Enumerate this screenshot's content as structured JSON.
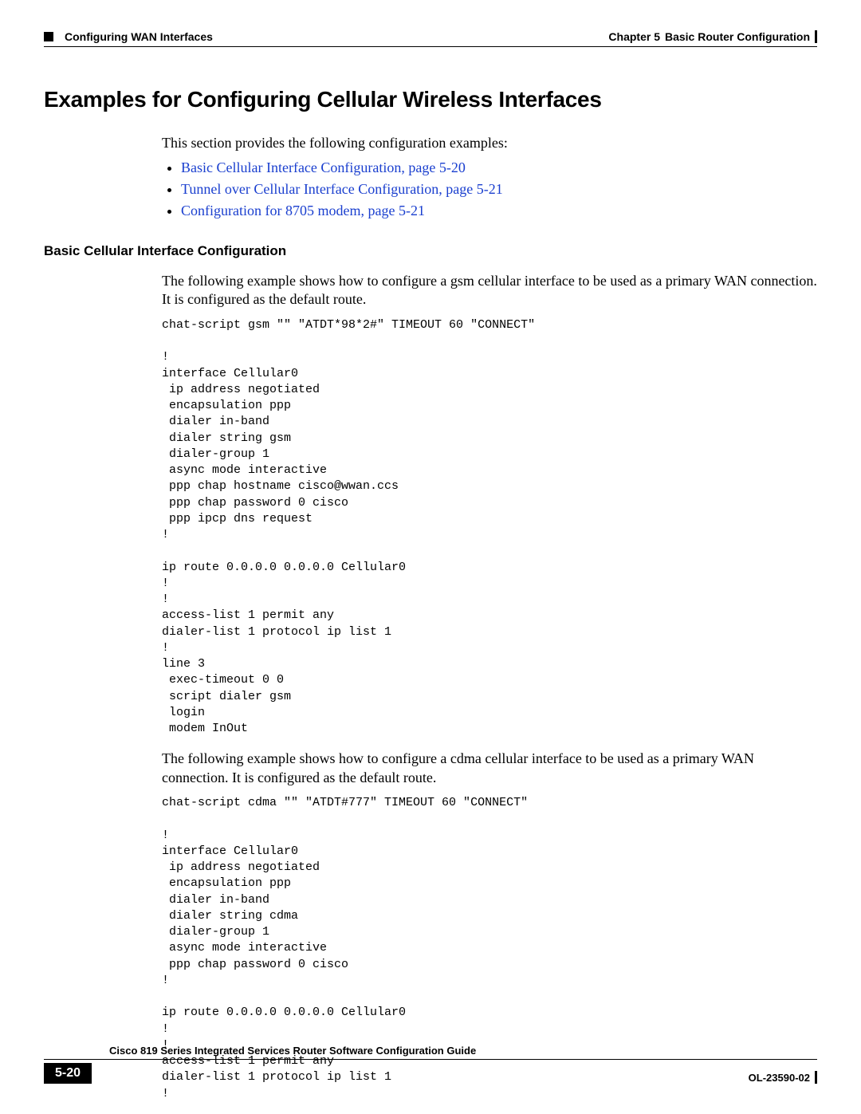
{
  "header": {
    "left_section": "Configuring WAN Interfaces",
    "right_chapter": "Chapter 5",
    "right_title": "Basic Router Configuration"
  },
  "section_title": "Examples for Configuring Cellular Wireless Interfaces",
  "intro": "This section provides the following configuration examples:",
  "links": [
    "Basic Cellular Interface Configuration, page 5-20",
    "Tunnel over Cellular Interface Configuration, page 5-21",
    "Configuration for 8705 modem, page 5-21"
  ],
  "subhead": "Basic Cellular Interface Configuration",
  "para1": "The following example shows how to configure a gsm cellular interface to be used as a primary WAN connection. It is configured as the default route.",
  "code1": "chat-script gsm \"\" \"ATDT*98*2#\" TIMEOUT 60 \"CONNECT\"\n\n!\ninterface Cellular0\n ip address negotiated\n encapsulation ppp\n dialer in-band\n dialer string gsm\n dialer-group 1\n async mode interactive\n ppp chap hostname cisco@wwan.ccs\n ppp chap password 0 cisco\n ppp ipcp dns request\n!\n\nip route 0.0.0.0 0.0.0.0 Cellular0\n!\n!\naccess-list 1 permit any\ndialer-list 1 protocol ip list 1\n!\nline 3\n exec-timeout 0 0\n script dialer gsm\n login\n modem InOut",
  "para2": "The following example shows how to configure a cdma cellular interface to be used as a primary WAN connection. It is configured as the default route.",
  "code2": "chat-script cdma \"\" \"ATDT#777\" TIMEOUT 60 \"CONNECT\"\n\n!\ninterface Cellular0\n ip address negotiated\n encapsulation ppp\n dialer in-band\n dialer string cdma\n dialer-group 1\n async mode interactive\n ppp chap password 0 cisco\n!\n\nip route 0.0.0.0 0.0.0.0 Cellular0\n!\n!\naccess-list 1 permit any\ndialer-list 1 protocol ip list 1\n!",
  "footer": {
    "guide": "Cisco 819 Series Integrated Services Router Software Configuration Guide",
    "page_number": "5-20",
    "doc_id": "OL-23590-02"
  }
}
